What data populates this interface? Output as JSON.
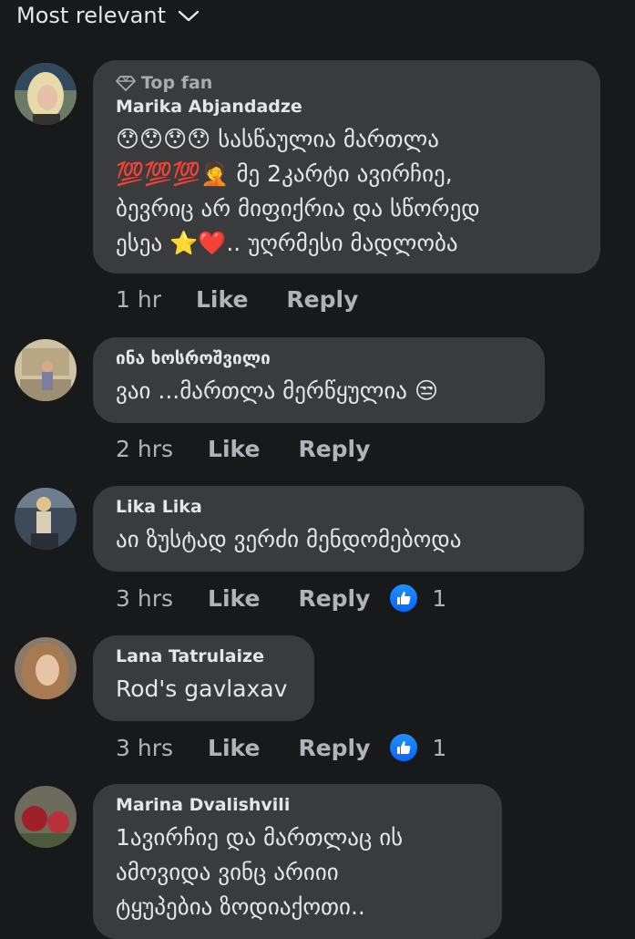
{
  "sort": {
    "label": "Most relevant"
  },
  "comments": [
    {
      "badge": "Top fan",
      "author": "Marika Abjandadze",
      "text": "😯😯😯😯 სასწაულია მართლა\n💯💯💯🤦 მე 2კარტი ავირჩიე,\nბევრიც არ მიფიქრია და სწორედ\nესეა ⭐❤️.. უღრმესი მადლობა",
      "time": "1 hr",
      "like": "Like",
      "reply": "Reply"
    },
    {
      "author": "ინა ხოსროშვილი",
      "text": "ვაი ...მართლა მერწყულია 😒",
      "time": "2 hrs",
      "like": "Like",
      "reply": "Reply"
    },
    {
      "author": "Lika Lika",
      "text": "აი ზუსტად ვერძი მენდომებოდა",
      "time": "3 hrs",
      "like": "Like",
      "reply": "Reply",
      "reactions": "1"
    },
    {
      "author": "Lana Tatrulaize",
      "text": "Rod's gavlaxav",
      "time": "3 hrs",
      "like": "Like",
      "reply": "Reply",
      "reactions": "1"
    },
    {
      "author": "Marina Dvalishvili",
      "text": "1ავირჩიე  და მართლაც ის\nამოვიდა ვინც არიიი\nტყუპებია  ზოდიაქოთი..",
      "time": "",
      "like": "",
      "reply": ""
    }
  ],
  "icons": {
    "sort": "chevron-down-icon",
    "badge": "diamond-icon",
    "reaction": "thumbs-up-icon"
  },
  "colors": {
    "background": "#18191a",
    "bubble": "#3a3b3c",
    "text": "#e4e6eb",
    "secondary": "#b0b3b8",
    "like_reaction": "#0866ff"
  }
}
